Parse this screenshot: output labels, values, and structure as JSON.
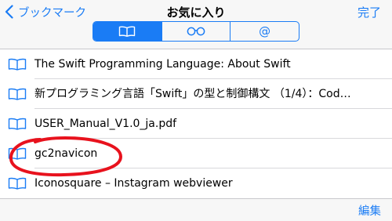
{
  "nav": {
    "back_label": "ブックマーク",
    "title": "お気に入り",
    "done_label": "完了"
  },
  "segments": [
    {
      "icon": "book-icon",
      "selected": true
    },
    {
      "icon": "glasses-icon",
      "selected": false
    },
    {
      "icon": "at-sign-icon",
      "label": "@",
      "selected": false
    }
  ],
  "bookmarks": [
    {
      "icon": "book-icon",
      "title": "The Swift Programming Language: About Swift"
    },
    {
      "icon": "book-icon",
      "title": "新プログラミング言語「Swift」の型と制御構文 （1/4）：Cod…"
    },
    {
      "icon": "book-icon",
      "title": "USER_Manual_V1.0_ja.pdf"
    },
    {
      "icon": "book-icon",
      "title": "gc2navicon"
    },
    {
      "icon": "book-icon",
      "title": "Iconosquare – Instagram webviewer"
    }
  ],
  "toolbar": {
    "edit_label": "編集"
  },
  "colors": {
    "accent": "#1a7cf5",
    "annotation": "#e8121d"
  }
}
